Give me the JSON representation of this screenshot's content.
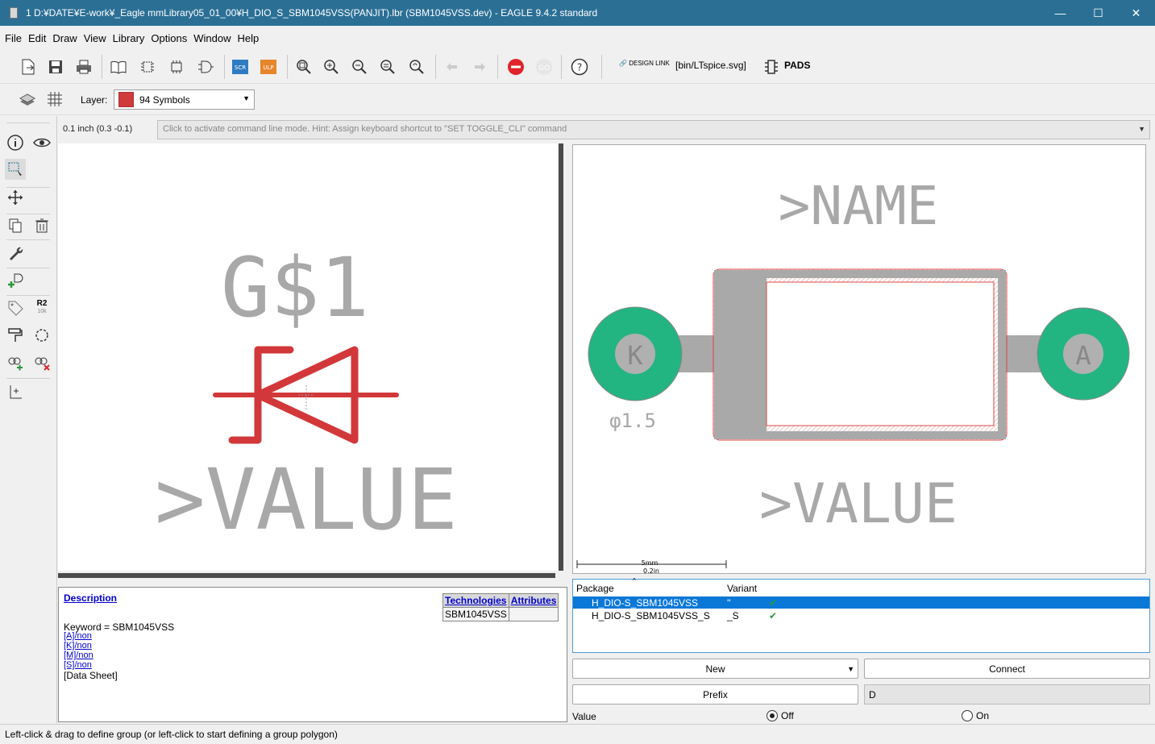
{
  "window": {
    "title": "1 D:¥DATE¥E-work¥_Eagle mmLibrary05_01_00¥H_DIO_S_SBM1045VSS(PANJIT).lbr (SBM1045VSS.dev) - EAGLE 9.4.2 standard",
    "minimize": "—",
    "maximize": "☐",
    "close": "✕"
  },
  "menu": [
    "File",
    "Edit",
    "Draw",
    "View",
    "Library",
    "Options",
    "Window",
    "Help"
  ],
  "toolbar": {
    "scr_label": "SCR",
    "ulp_label": "ULP",
    "design_link": "DESIGN LINK",
    "ltspice": "[bin/LTspice.svg]",
    "pads": "PADS"
  },
  "layer": {
    "label": "Layer:",
    "selected": "94 Symbols",
    "color": "#d03a3a"
  },
  "lefttools": {
    "r2_label": "R2",
    "r2_sub": "10k"
  },
  "coords": "0.1 inch (0.3 -0.1)",
  "command_hint": "Click to activate command line mode. Hint: Assign keyboard shortcut to \"SET TOGGLE_CLI\" command",
  "symbol": {
    "name_text": "G$1",
    "value_text": ">VALUE"
  },
  "package": {
    "name_text": ">NAME",
    "value_text": ">VALUE",
    "pad_k": "K",
    "pad_a": "A",
    "drill_label": "φ1.5",
    "scale_top": "5mm",
    "scale_bottom": "0.2in"
  },
  "description": {
    "title": "Description",
    "tech_header": "Technologies",
    "attr_header": "Attributes",
    "tech_value": "SBM1045VSS",
    "keyword": "Keyword = SBM1045VSS",
    "pins": [
      "[A]/non",
      "[K]/non",
      "[M]/non",
      "[S]/non"
    ],
    "datasheet": "[Data Sheet]"
  },
  "package_list": {
    "col_package": "Package",
    "col_variant": "Variant",
    "rows": [
      {
        "package": "H_DIO-S_SBM1045VSS",
        "variant": "''",
        "check": "✔"
      },
      {
        "package": "H_DIO-S_SBM1045VSS_S",
        "variant": "_S",
        "check": "✔"
      }
    ]
  },
  "buttons": {
    "new": "New",
    "connect": "Connect",
    "prefix": "Prefix",
    "prefix_value": "D"
  },
  "value_opt": {
    "label": "Value",
    "off": "Off",
    "on": "On"
  },
  "status": "Left-click & drag to define group (or left-click to start defining a group polygon)"
}
